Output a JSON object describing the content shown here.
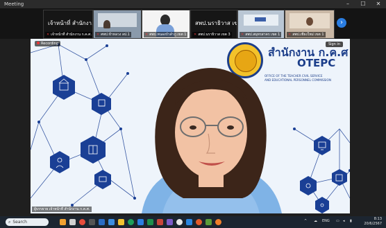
{
  "window": {
    "title": "Meeting",
    "controls": {
      "minimize": "–",
      "maximize": "☐",
      "close": "✕"
    }
  },
  "strip": {
    "tiles": [
      {
        "name": "เจ้าหน้าที่ สำนักงา...",
        "label": "เจ้าหน้าที่ สำนักงาน ก.ค.ศ."
      },
      {
        "label": "ศพป.ข้าหลวง ลป.1"
      },
      {
        "label": "ศพป.หนองบัวลำภู เขต 1"
      },
      {
        "name": "สพป.นราธิวาส เข...",
        "label": "สพป.นราธิวาส เขต 3"
      },
      {
        "label": "สพป.สมุทรสาคร เขต 1"
      },
      {
        "label": "สพป.เชียงใหม่ เขต 1"
      }
    ],
    "next_arrow": "›"
  },
  "video": {
    "recording_label": "Recording",
    "signin_label": "Sign in",
    "org_thai": "สำนักงาน ก.ค.ศ",
    "org_english": "OTEPC",
    "org_sub_line1": "OFFICE OF THE TEACHER CIVIL SERVICE",
    "org_sub_line2": "AND EDUCATIONAL PERSONNEL COMMISSION",
    "speaker_label": "ผู้บรรยาย เจ้าหน้าที่ สำนักงาน ก.ค.ศ.",
    "colors": {
      "brand": "#1c3e8a",
      "network": "#1a3f95",
      "seal_gold": "#f3c22a"
    }
  },
  "taskbar": {
    "search_label": "Search",
    "tray": {
      "chevron": "^",
      "language": "ENG",
      "time": "8:13",
      "date": "20/6/2567"
    }
  }
}
